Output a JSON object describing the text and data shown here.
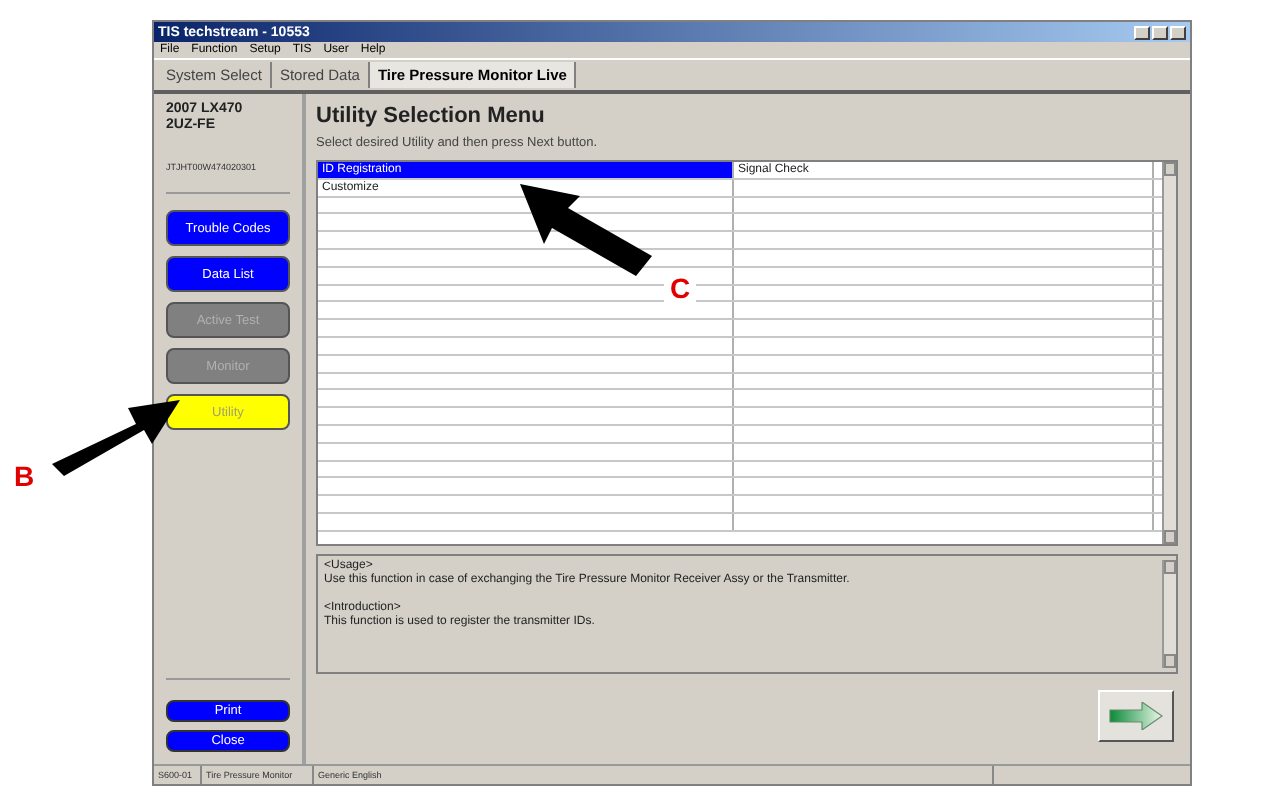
{
  "window": {
    "title": "TIS techstream - 10553"
  },
  "menu": [
    "File",
    "Function",
    "Setup",
    "TIS",
    "User",
    "Help"
  ],
  "tabs": [
    {
      "label": "System Select",
      "selected": false
    },
    {
      "label": "Stored Data",
      "selected": false
    },
    {
      "label": "Tire Pressure Monitor Live",
      "selected": true
    }
  ],
  "vehicle": {
    "model": "2007 LX470",
    "engine": "2UZ-FE",
    "vin": "JTJHT00W474020301"
  },
  "sidebar": {
    "items": [
      {
        "label": "Trouble Codes",
        "disabled": false,
        "selected": false
      },
      {
        "label": "Data List",
        "disabled": false,
        "selected": false
      },
      {
        "label": "Active Test",
        "disabled": true,
        "selected": false
      },
      {
        "label": "Monitor",
        "disabled": true,
        "selected": false
      },
      {
        "label": "Utility",
        "disabled": false,
        "selected": true
      }
    ],
    "bottom_buttons": [
      "Print",
      "Close"
    ]
  },
  "main": {
    "heading": "Utility Selection Menu",
    "instruction": "Select desired Utility and then press Next button.",
    "table": {
      "rows": [
        {
          "column_1": "ID Registration",
          "column_2": "Signal Check",
          "selected": true
        },
        {
          "column_1": "Customize",
          "selected": false
        }
      ]
    },
    "description": [
      "<Usage>",
      "Use this function in case of exchanging the Tire Pressure Monitor Receiver Assy or the Transmitter.",
      "<Introduction>",
      "This function is used to register the transmitter IDs."
    ]
  },
  "status_bar": [
    "S600-01",
    "Tire Pressure Monitor",
    "Generic English"
  ],
  "annotations": [
    {
      "label": "B"
    },
    {
      "label": "C"
    }
  ]
}
